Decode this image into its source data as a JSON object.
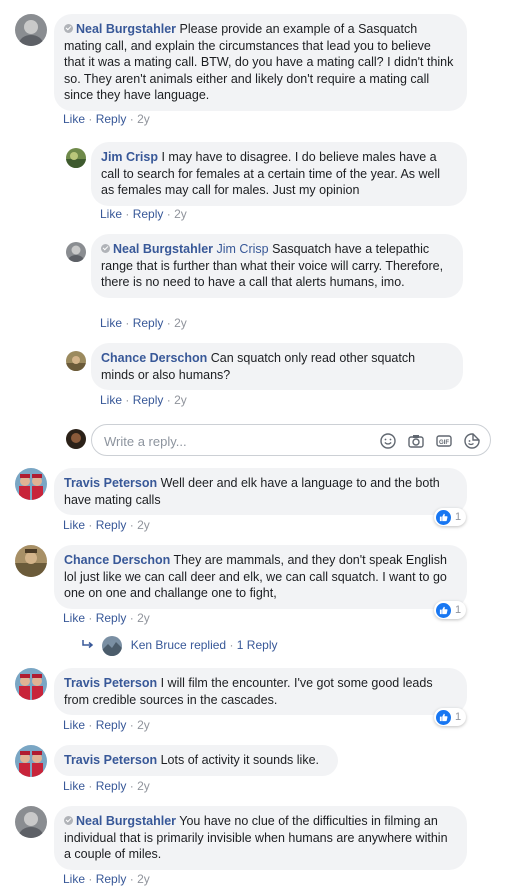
{
  "action_like": "Like",
  "action_reply": "Reply",
  "separator": "·",
  "reply_placeholder": "Write a reply...",
  "comments": [
    {
      "name": "Neal Burgstahler",
      "text": "Please provide an example of a Sasquatch mating call, and explain the circumstances that lead you to believe that it was a mating call. BTW, do you have a mating call? I didn't think so. They aren't animals either and likely don't require a mating call since they have language.",
      "time": "2y"
    },
    {
      "name": "Jim Crisp",
      "text": "I may have to disagree. I do believe males have a call to search for females at a certain time of the year. As well as females may call for males. Just my opinion",
      "time": "2y"
    },
    {
      "name": "Neal Burgstahler",
      "tag": "Jim Crisp",
      "text": "Sasquatch have a telepathic range that is further than what their voice will carry. Therefore, there is no need to have a call that alerts humans, imo.",
      "time": "2y"
    },
    {
      "name": "Chance Derschon",
      "text": "Can squatch only read other squatch minds or also humans?",
      "time": "2y"
    },
    {
      "name": "Travis Peterson",
      "text": "Well deer and elk have a language to and the both have mating calls",
      "time": "2y",
      "reactions": "1"
    },
    {
      "name": "Chance Derschon",
      "text": "They are mammals, and they don't speak English lol just like we can call deer and elk, we can call squatch. I want to go one on one and challange one to fight,",
      "time": "2y",
      "reactions": "1"
    },
    {
      "name": "Travis Peterson",
      "text": "I will film the encounter. I've got some good leads from credible sources in the cascades.",
      "time": "2y",
      "reactions": "1"
    },
    {
      "name": "Travis Peterson",
      "text": "Lots of activity it sounds like.",
      "time": "2y"
    },
    {
      "name": "Neal Burgstahler",
      "text": "You have no clue of the difficulties in filming an individual that is primarily invisible when humans are anywhere within a couple of miles.",
      "time": "2y"
    }
  ],
  "replied": {
    "name": "Ken Bruce",
    "verb": "replied",
    "count_label": "1 Reply"
  },
  "colors": {
    "link": "#385898",
    "bubble": "#f2f3f5",
    "meta": "#90949c",
    "like_blue": "#1877f2"
  },
  "icons": [
    "verified-badge-icon",
    "emoji-icon",
    "camera-icon",
    "gif-icon",
    "sticker-icon",
    "like-reaction-icon",
    "reply-arrow-icon"
  ]
}
